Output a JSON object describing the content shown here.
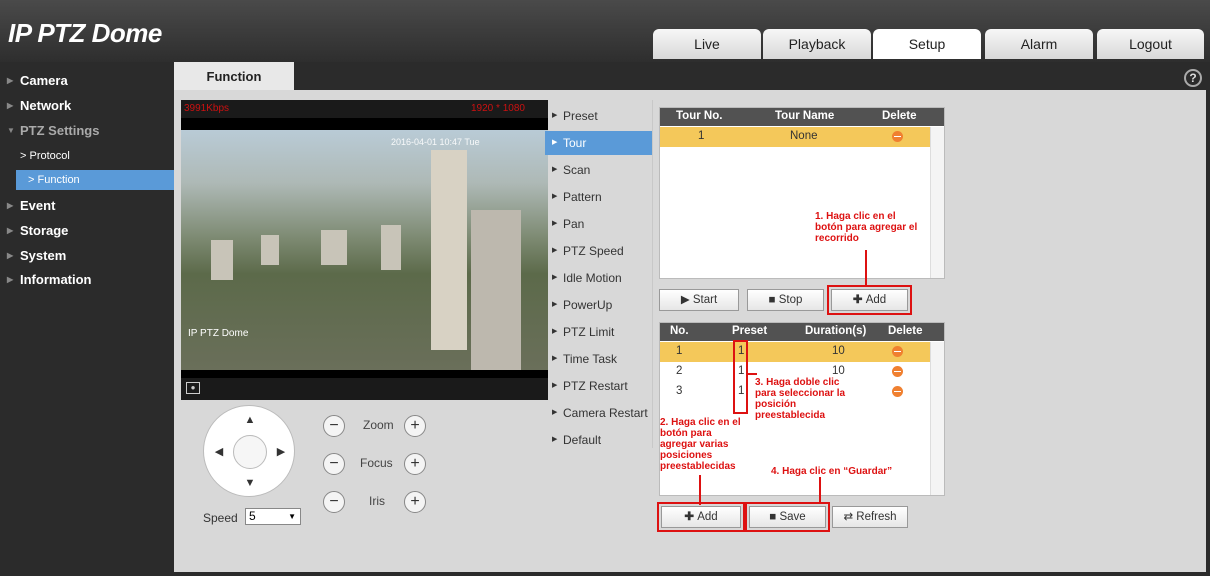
{
  "app": {
    "title": "IP PTZ Dome"
  },
  "tabs": [
    {
      "label": "Live",
      "active": false
    },
    {
      "label": "Playback",
      "active": false
    },
    {
      "label": "Setup",
      "active": true
    },
    {
      "label": "Alarm",
      "active": false
    },
    {
      "label": "Logout",
      "active": false
    }
  ],
  "sidebar": {
    "items": [
      {
        "label": "Camera"
      },
      {
        "label": "Network"
      },
      {
        "label": "PTZ Settings"
      },
      {
        "label": "Protocol"
      },
      {
        "label": "Function"
      },
      {
        "label": "Event"
      },
      {
        "label": "Storage"
      },
      {
        "label": "System"
      },
      {
        "label": "Information"
      }
    ]
  },
  "page": {
    "tab_label": "Function",
    "help_icon": "?"
  },
  "video": {
    "bitrate": "3991Kbps",
    "resolution": "1920 * 1080",
    "timestamp": "2016-04-01 10:47 Tue",
    "camera_label": "IP PTZ Dome",
    "snapshot_icon": "camera-icon"
  },
  "ptz": {
    "zoom_label": "Zoom",
    "focus_label": "Focus",
    "iris_label": "Iris",
    "minus": "−",
    "plus": "+",
    "speed_label": "Speed",
    "speed_value": "5",
    "arrows": {
      "up": "▲",
      "down": "▼",
      "left": "◀",
      "right": "▶"
    }
  },
  "function_menu": {
    "items": [
      {
        "label": "Preset"
      },
      {
        "label": "Tour"
      },
      {
        "label": "Scan"
      },
      {
        "label": "Pattern"
      },
      {
        "label": "Pan"
      },
      {
        "label": "PTZ Speed"
      },
      {
        "label": "Idle Motion"
      },
      {
        "label": "PowerUp"
      },
      {
        "label": "PTZ Limit"
      },
      {
        "label": "Time Task"
      },
      {
        "label": "PTZ Restart"
      },
      {
        "label": "Camera Restart"
      },
      {
        "label": "Default"
      }
    ],
    "selected": "Tour"
  },
  "tour_table": {
    "headers": {
      "no": "Tour No.",
      "name": "Tour Name",
      "delete": "Delete"
    },
    "rows": [
      {
        "no": "1",
        "name": "None"
      }
    ],
    "buttons": {
      "start": "Start",
      "stop": "Stop",
      "add": "Add"
    }
  },
  "preset_table": {
    "headers": {
      "no": "No.",
      "preset": "Preset",
      "duration": "Duration(s)",
      "delete": "Delete"
    },
    "rows": [
      {
        "no": "1",
        "preset": "1",
        "duration": "10"
      },
      {
        "no": "2",
        "preset": "1",
        "duration": "10"
      },
      {
        "no": "3",
        "preset": "1",
        "duration": "10"
      }
    ],
    "buttons": {
      "add": "Add",
      "save": "Save",
      "refresh": "Refresh"
    }
  },
  "annotations": {
    "a1": "1. Haga clic en el botón para agregar el recorrido",
    "a2": "2. Haga clic en el botón para agregar varias posiciones preestablecidas",
    "a3": "3. Haga doble clic para seleccionar la posición preestablecida",
    "a4": "4. Haga clic en “Guardar”"
  },
  "colors": {
    "accent": "#5a9ad8",
    "highlight": "#f4c85a",
    "annotation": "#dd1111",
    "header_dark": "#525252"
  }
}
